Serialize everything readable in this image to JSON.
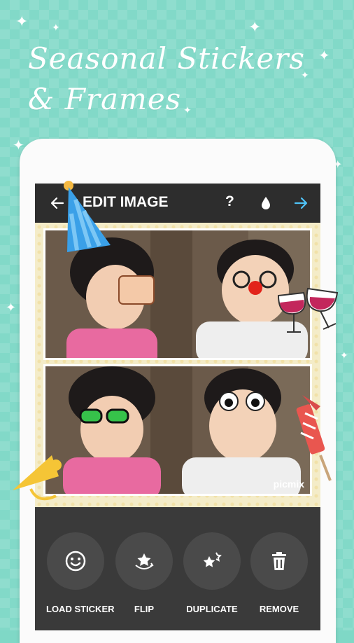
{
  "headline": {
    "line1": "Seasonal Stickers",
    "line2": "& Frames"
  },
  "appbar": {
    "title": "EDIT IMAGE",
    "help": "?"
  },
  "watermark": "picmix",
  "tools": [
    {
      "label": "LOAD STICKER",
      "icon": "smiley-icon"
    },
    {
      "label": "FLIP",
      "icon": "flip-star-icon"
    },
    {
      "label": "DUPLICATE",
      "icon": "duplicate-star-icon"
    },
    {
      "label": "REMOVE",
      "icon": "trash-icon"
    }
  ],
  "colors": {
    "background": "#82d9c8",
    "accent": "#4fc3f7",
    "toolbar": "#2d2d2d",
    "panel": "#3a3a3a"
  }
}
